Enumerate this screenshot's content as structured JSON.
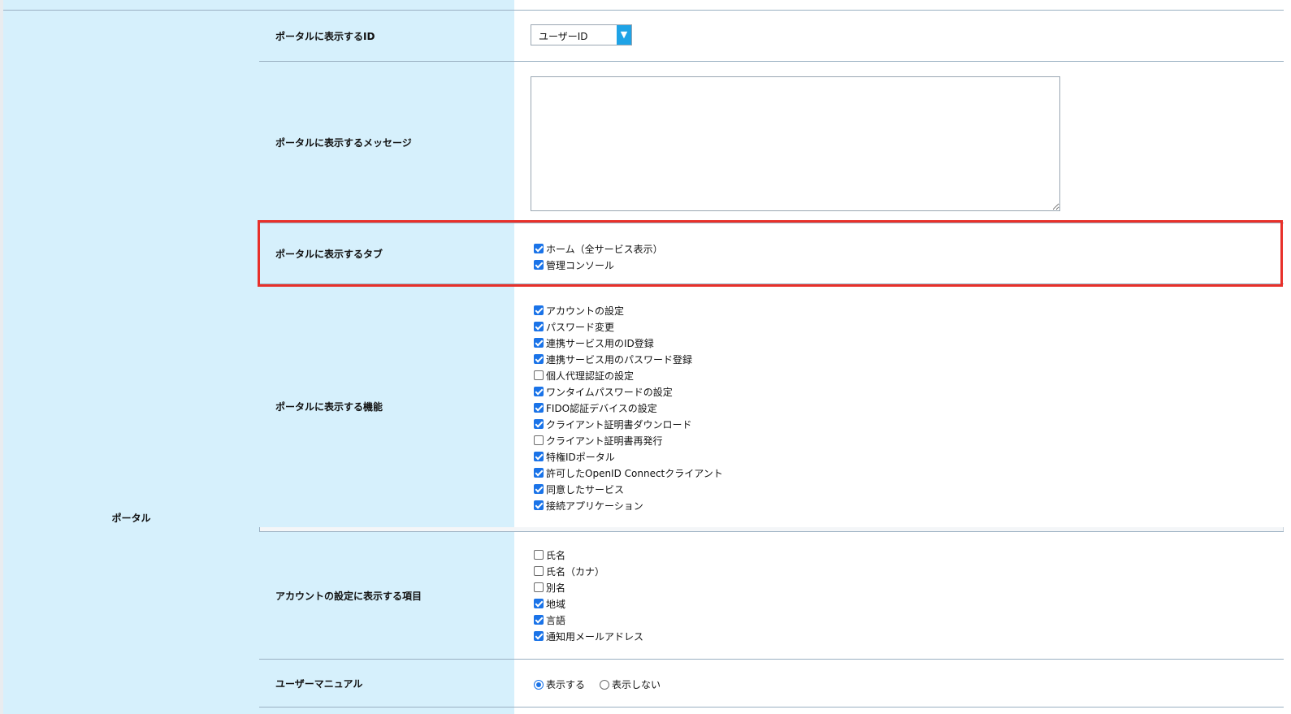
{
  "section": {
    "label": "ポータル"
  },
  "rows": {
    "portal_id": {
      "label": "ポータルに表示するID",
      "select_value": "ユーザーID",
      "arrow": "▼"
    },
    "portal_message": {
      "label": "ポータルに表示するメッセージ",
      "value": ""
    },
    "portal_tabs": {
      "label": "ポータルに表示するタブ",
      "items": [
        {
          "label": "ホーム（全サービス表示）",
          "checked": true
        },
        {
          "label": "管理コンソール",
          "checked": true
        }
      ]
    },
    "portal_functions": {
      "label": "ポータルに表示する機能",
      "items": [
        {
          "label": "アカウントの設定",
          "checked": true
        },
        {
          "label": "パスワード変更",
          "checked": true
        },
        {
          "label": "連携サービス用のID登録",
          "checked": true
        },
        {
          "label": "連携サービス用のパスワード登録",
          "checked": true
        },
        {
          "label": "個人代理認証の設定",
          "checked": false
        },
        {
          "label": "ワンタイムパスワードの設定",
          "checked": true
        },
        {
          "label": "FIDO認証デバイスの設定",
          "checked": true
        },
        {
          "label": "クライアント証明書ダウンロード",
          "checked": true
        },
        {
          "label": "クライアント証明書再発行",
          "checked": false
        },
        {
          "label": "特権IDポータル",
          "checked": true
        },
        {
          "label": "許可したOpenID Connectクライアント",
          "checked": true
        },
        {
          "label": "同意したサービス",
          "checked": true
        },
        {
          "label": "接続アプリケーション",
          "checked": true
        }
      ]
    },
    "account_items": {
      "label": "アカウントの設定に表示する項目",
      "items": [
        {
          "label": "氏名",
          "checked": false
        },
        {
          "label": "氏名（カナ）",
          "checked": false
        },
        {
          "label": "別名",
          "checked": false
        },
        {
          "label": "地域",
          "checked": true
        },
        {
          "label": "言語",
          "checked": true
        },
        {
          "label": "通知用メールアドレス",
          "checked": true
        }
      ]
    },
    "user_manual": {
      "label": "ユーザーマニュアル",
      "options": [
        {
          "label": "表示する",
          "selected": true
        },
        {
          "label": "表示しない",
          "selected": false
        }
      ]
    }
  },
  "colors": {
    "accent": "#1a73e8",
    "label_bg": "#d6f0fc",
    "highlight": "#e8302a",
    "select_arrow": "#1fa3e6"
  }
}
